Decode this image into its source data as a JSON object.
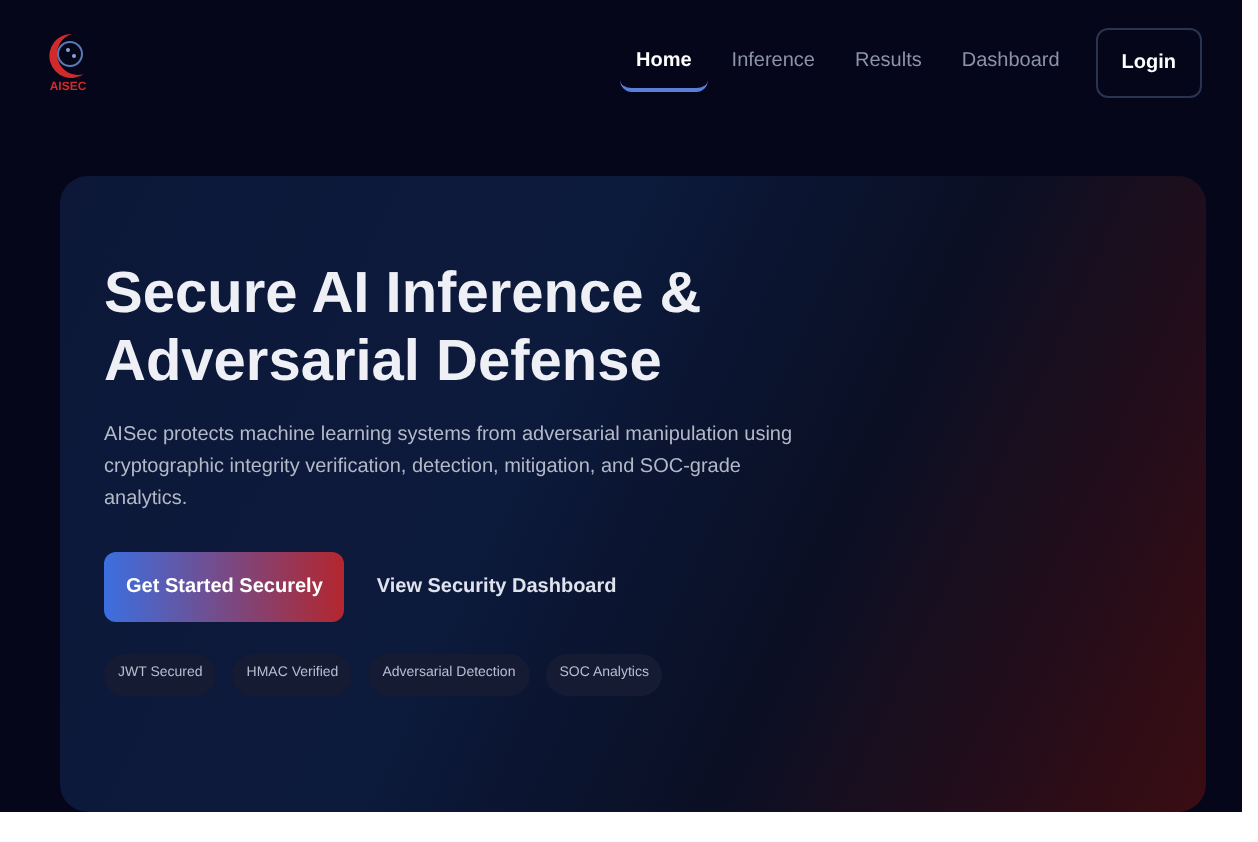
{
  "logo": {
    "text": "AISEC"
  },
  "nav": [
    {
      "label": "Home",
      "selected": true
    },
    {
      "label": "Inference",
      "selected": false
    },
    {
      "label": "Results",
      "selected": false
    },
    {
      "label": "Dashboard",
      "selected": false
    }
  ],
  "login_button": "Login",
  "hero": {
    "title_lines": [
      "Secure AI Inference &",
      "Adversarial Defense"
    ],
    "description": "AISec protects machine learning systems from adversarial manipulation using cryptographic integrity verification, detection, mitigation, and SOC-grade analytics.",
    "primary_button": "Get Started Securely",
    "secondary_link": "View Security Dashboard",
    "tags": [
      "JWT Secured",
      "HMAC Verified",
      "Adversarial Detection",
      "SOC Analytics"
    ]
  }
}
